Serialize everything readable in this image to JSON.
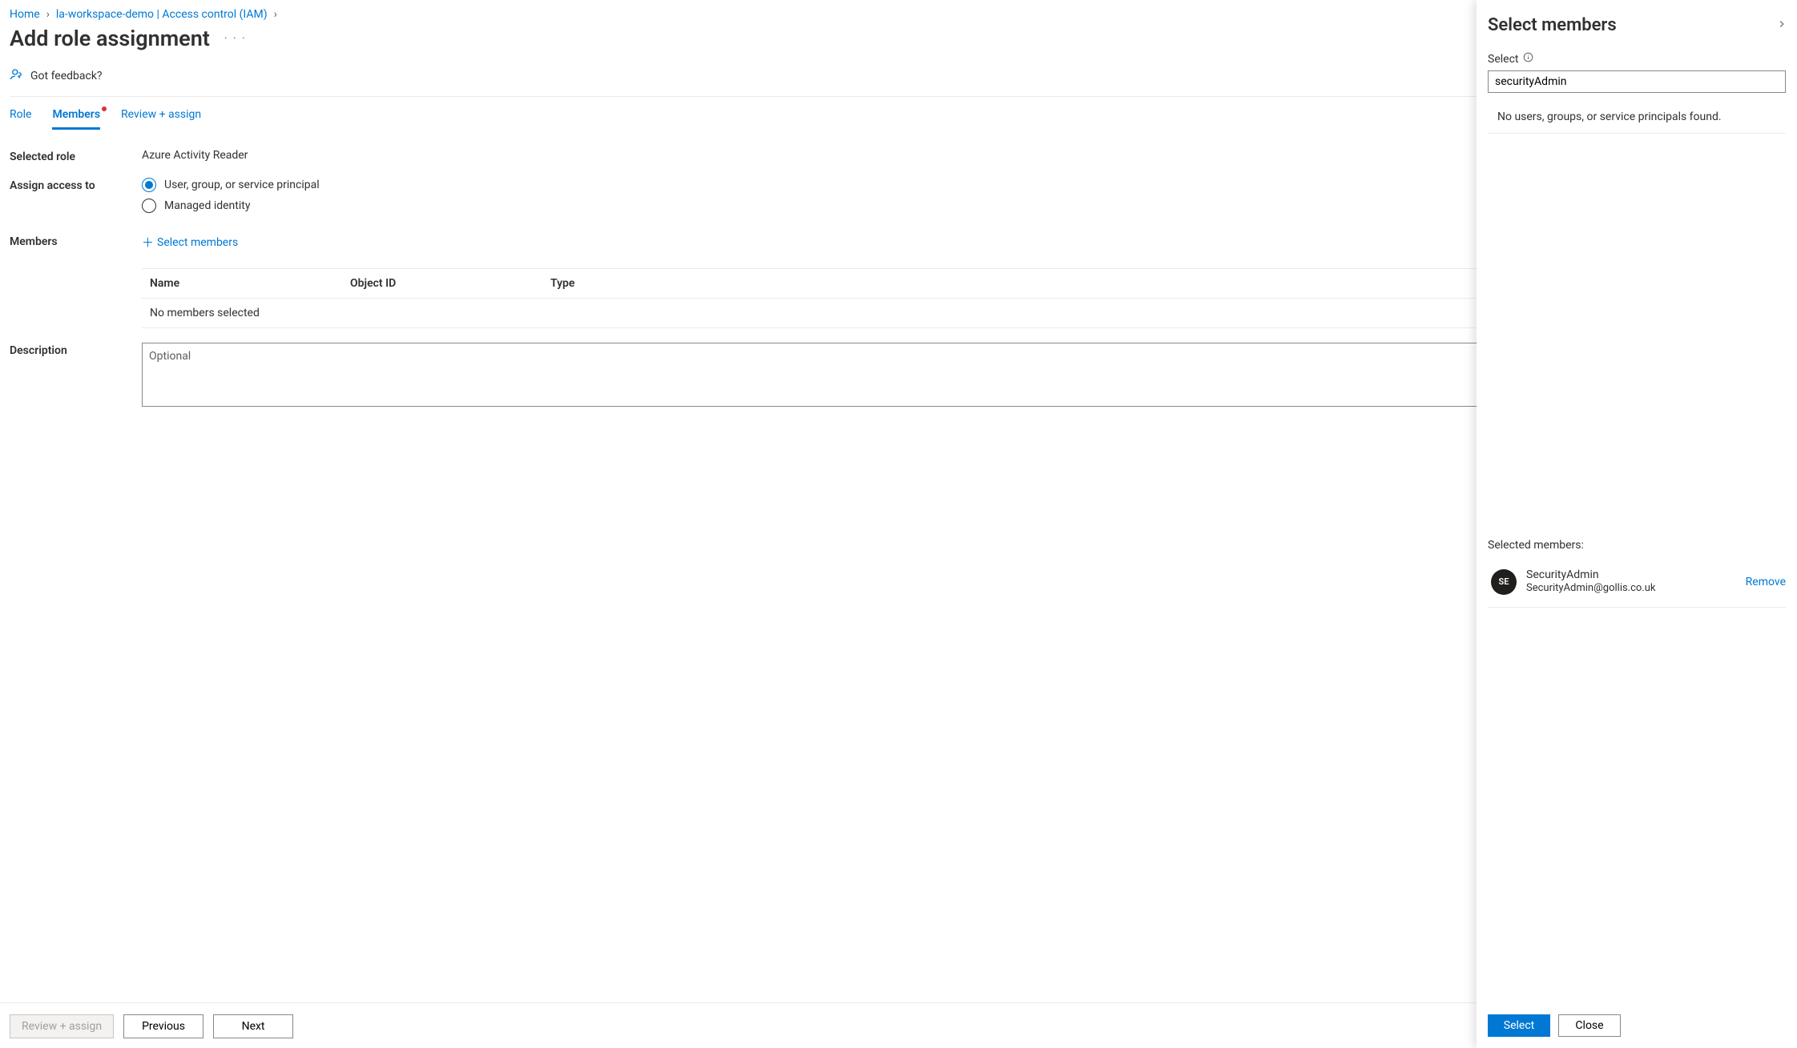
{
  "breadcrumb": {
    "home": "Home",
    "workspace": "la-workspace-demo | Access control (IAM)"
  },
  "page_title": "Add role assignment",
  "feedback_label": "Got feedback?",
  "tabs": {
    "role": "Role",
    "members": "Members",
    "review": "Review + assign"
  },
  "form": {
    "selected_role_label": "Selected role",
    "selected_role_value": "Azure Activity Reader",
    "assign_access_label": "Assign access to",
    "radio_user": "User, group, or service principal",
    "radio_managed": "Managed identity",
    "members_label": "Members",
    "select_members_link": "Select members",
    "table": {
      "col_name": "Name",
      "col_objectid": "Object ID",
      "col_type": "Type",
      "empty": "No members selected"
    },
    "description_label": "Description",
    "description_placeholder": "Optional"
  },
  "footer": {
    "review": "Review + assign",
    "previous": "Previous",
    "next": "Next"
  },
  "panel": {
    "title": "Select members",
    "select_label": "Select",
    "search_value": "securityAdmin",
    "noresults": "No users, groups, or service principals found.",
    "selected_heading": "Selected members:",
    "member": {
      "initials": "SE",
      "name": "SecurityAdmin",
      "email": "SecurityAdmin@gollis.co.uk",
      "remove": "Remove"
    },
    "select_btn": "Select",
    "close_btn": "Close"
  }
}
